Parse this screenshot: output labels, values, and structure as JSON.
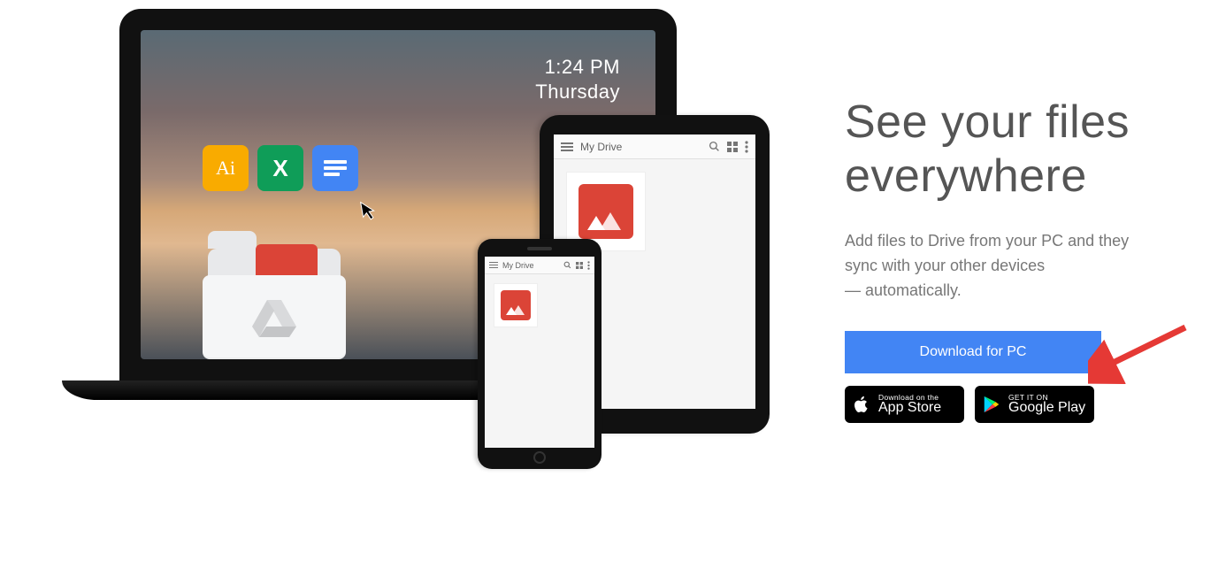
{
  "laptop": {
    "clock_time": "1:24 PM",
    "clock_day": "Thursday",
    "apps": {
      "ai": "Ai",
      "sheets": "X"
    }
  },
  "tablet": {
    "title": "My Drive"
  },
  "phone": {
    "title": "My Drive"
  },
  "panel": {
    "headline_l1": "See your files",
    "headline_l2": "everywhere",
    "desc_l1": "Add files to Drive from your PC and they",
    "desc_l2": "sync with your other devices",
    "desc_l3": "— automatically.",
    "download_label": "Download for PC",
    "appstore_top": "Download on the",
    "appstore_bottom": "App Store",
    "play_top": "GET IT ON",
    "play_bottom": "Google Play"
  }
}
